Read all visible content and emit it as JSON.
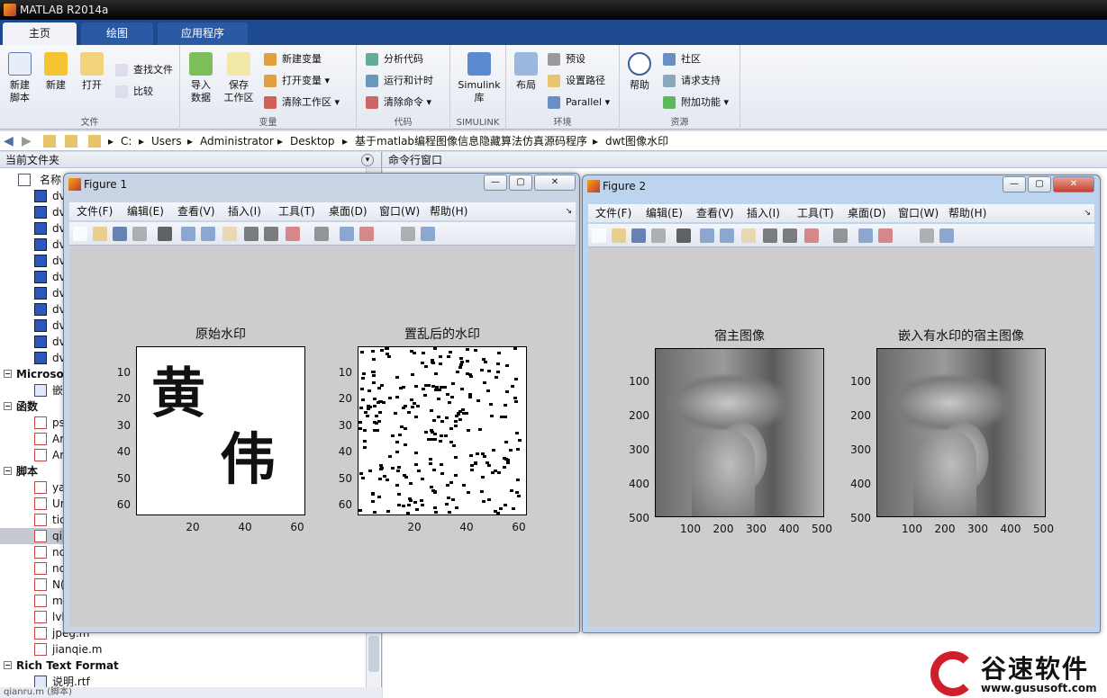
{
  "app": {
    "title": "MATLAB R2014a"
  },
  "tabs": [
    {
      "label": "主页"
    },
    {
      "label": "绘图"
    },
    {
      "label": "应用程序"
    }
  ],
  "ribbon": {
    "file": {
      "label": "文件",
      "new_script": "新建\n脚本",
      "new": "新建",
      "open": "打开",
      "find_files": "查找文件",
      "compare": "比较"
    },
    "variable": {
      "label": "变量",
      "import": "导入\n数据",
      "save_ws": "保存\n工作区",
      "new_var": "新建变量",
      "open_var": "打开变量 ▾",
      "clear_ws": "清除工作区 ▾"
    },
    "code": {
      "label": "代码",
      "analyze": "分析代码",
      "run_time": "运行和计时",
      "clear_cmd": "清除命令 ▾"
    },
    "simulink": {
      "label": "SIMULINK",
      "lib": "Simulink\n库"
    },
    "env": {
      "label": "环境",
      "layout": "布局",
      "prefs": "预设",
      "set_path": "设置路径",
      "parallel": "Parallel ▾"
    },
    "res": {
      "label": "资源",
      "help": "帮助",
      "community": "社区",
      "support": "请求支持",
      "addons": "附加功能 ▾"
    }
  },
  "path": [
    "C:",
    "Users",
    "Administrator",
    "Desktop",
    "基于matlab编程图像信息隐藏算法仿真源码程序",
    "dwt图像水印"
  ],
  "panes": {
    "current_folder": "当前文件夹",
    "command_window": "命令行窗口",
    "name_col": "名称"
  },
  "files": [
    {
      "g": "",
      "name": "名称",
      "type": "hdr"
    },
    {
      "name": "dv",
      "type": "bmp"
    },
    {
      "name": "dv",
      "type": "bmp"
    },
    {
      "name": "dv",
      "type": "bmp"
    },
    {
      "name": "dv",
      "type": "bmp"
    },
    {
      "name": "dv",
      "type": "bmp"
    },
    {
      "name": "dv",
      "type": "bmp"
    },
    {
      "name": "dv",
      "type": "bmp"
    },
    {
      "name": "dv",
      "type": "bmp"
    },
    {
      "name": "dv",
      "type": "bmp"
    },
    {
      "name": "dv",
      "type": "bmp"
    },
    {
      "name": "dv",
      "type": "bmp"
    },
    {
      "name": "Microso",
      "type": "grp"
    },
    {
      "name": "嵌",
      "type": "rtf"
    },
    {
      "name": "函数",
      "type": "grp"
    },
    {
      "name": "ps",
      "type": "m"
    },
    {
      "name": "Ar",
      "type": "m"
    },
    {
      "name": "Ar",
      "type": "m"
    },
    {
      "name": "脚本",
      "type": "grp"
    },
    {
      "name": "ya",
      "type": "m"
    },
    {
      "name": "Ur",
      "type": "m"
    },
    {
      "name": "tic",
      "type": "m"
    },
    {
      "name": "qi",
      "type": "m"
    },
    {
      "name": "nc",
      "type": "m"
    },
    {
      "name": "nc",
      "type": "m"
    },
    {
      "name": "N(",
      "type": "m"
    },
    {
      "name": "m",
      "type": "m"
    },
    {
      "name": "lvl",
      "type": "m"
    },
    {
      "name": "jpeg.m",
      "type": "m"
    },
    {
      "name": "jianqie.m",
      "type": "m"
    },
    {
      "name": "Rich Text Format",
      "type": "grp"
    },
    {
      "name": "说明.rtf",
      "type": "rtf"
    }
  ],
  "status": {
    "bottom_file": "qianru.m (脚本)"
  },
  "figmenu": [
    "文件(F)",
    "编辑(E)",
    "查看(V)",
    "插入(I)",
    "工具(T)",
    "桌面(D)",
    "窗口(W)",
    "帮助(H)"
  ],
  "fig1": {
    "title": "Figure 1",
    "ax1_title": "原始水印",
    "ax2_title": "置乱后的水印",
    "yticks": [
      "10",
      "20",
      "30",
      "40",
      "50",
      "60"
    ],
    "xticks": [
      "20",
      "40",
      "60"
    ]
  },
  "fig2": {
    "title": "Figure 2",
    "ax1_title": "宿主图像",
    "ax2_title": "嵌入有水印的宿主图像",
    "yticks": [
      "100",
      "200",
      "300",
      "400",
      "500"
    ],
    "xticks": [
      "100",
      "200",
      "300",
      "400",
      "500"
    ]
  },
  "watermark": {
    "brand": "谷速软件",
    "url": "www.gususoft.com"
  }
}
